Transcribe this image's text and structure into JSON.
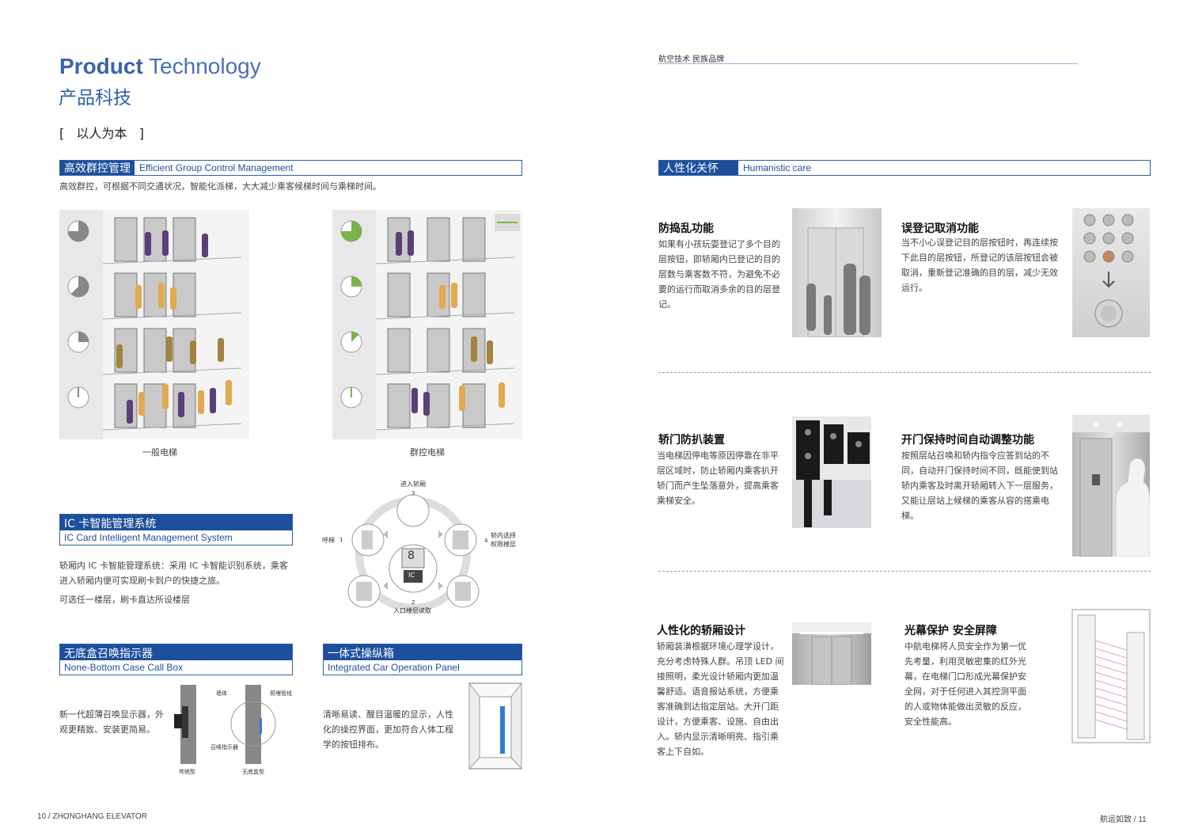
{
  "left": {
    "heading_en_bold": "Product",
    "heading_en_light": "Technology",
    "heading_cn": "产品科技",
    "motto": "[   以人为本   ]",
    "group_control": {
      "cn": "高效群控管理",
      "en": "Efficient Group Control Management",
      "desc": "高效群控，可根据不同交通状况，智能化派梯，大大减少乘客候梯时间与乘梯时间。",
      "caption_left": "一般电梯",
      "caption_right": "群控电梯"
    },
    "ic_card": {
      "cn": "IC 卡智能管理系统",
      "en": "IC Card Intelligent Management System",
      "desc1": "轿厢内 IC 卡智能管理系统：采用 IC 卡智能识别系统，乘客进入轿厢内便可实现刷卡到户的快捷之旅。",
      "desc2": "可选任一楼层，刷卡直达所设楼层",
      "diagram": {
        "top_label": "进入轿厢",
        "left_label": "呼梯",
        "right_label": "轿内选择\n权限楼层",
        "bottom_label": "入口楼层读取",
        "center_digit": "8",
        "center_card": "IC",
        "n1": "1",
        "n2": "2",
        "n3": "3",
        "n4": "4"
      }
    },
    "call_box": {
      "cn": "无底盒召唤指示器",
      "en": "None-Bottom Case Call Box",
      "desc": "新一代超薄召唤显示器，外观更精致、安装更简易。",
      "lbl_wall": "墙体",
      "lbl_pipe": "预埋管线",
      "lbl_indicator": "召唤指示器",
      "lbl_traditional": "传统型",
      "lbl_nobox": "无底盒型"
    },
    "panel": {
      "cn": "一体式操纵箱",
      "en": "Integrated Car Operation Panel",
      "desc": "清晰易读、醒目温暖的显示，人性化的操控界面，更加符合人体工程学的按钮排布。"
    },
    "footer": "10 / ZHONGHANG ELEVATOR"
  },
  "right": {
    "header": "航空技术 民族品牌",
    "section": {
      "cn": "人性化关怀",
      "en": "Humanistic care"
    },
    "features": [
      {
        "title": "防捣乱功能",
        "text": "如果有小孩玩耍登记了多个目的层按钮，即轿厢内已登记的目的层数与乘客数不符，为避免不必要的运行而取消多余的目的层登记。"
      },
      {
        "title": "误登记取消功能",
        "text": "当不小心误登记目的层按钮时，再连续按下此目的层按钮，所登记的该层按钮会被取消，重新登记准确的目的层，减少无效运行。"
      },
      {
        "title": "轿门防扒装置",
        "text": "当电梯因停电等原因停靠在非平层区域时，防止轿厢内乘客扒开轿门而产生坠落意外，提高乘客乘梯安全。"
      },
      {
        "title": "开门保持时间自动调整功能",
        "text": "按照层站召唤和轿内指令应答到站的不同，自动开门保持时间不同，既能使到站轿内乘客及时离开轿厢转入下一层服务，又能让层站上候梯的乘客从容的搭乘电梯。"
      },
      {
        "title": "人性化的轿厢设计",
        "text": "轿厢装潢根据环境心理学设计，充分考虑特殊人群。吊顶 LED 间接照明，柔光设计轿厢内更加温馨舒适。语音报站系统，方便乘客准确到达指定层站。大开门距设计，方便乘客、设施、自由出入。轿内显示清晰明亮、指引乘客上下自如。"
      },
      {
        "title": "光幕保护 安全屏障",
        "text": "中航电梯将人员安全作为第一优先考量，利用灵敏密集的红外光幕，在电梯门口形成光幕保护安全网，对于任何进入其控测平面的人或物体能做出灵敏的反应，安全性能高。"
      }
    ],
    "footer": "航运如致 / 11"
  },
  "colors": {
    "brand_blue": "#1e4f9c",
    "accent_gold": "#e2a94f",
    "accent_purple": "#5b3f78",
    "accent_green": "#7bb34a"
  }
}
